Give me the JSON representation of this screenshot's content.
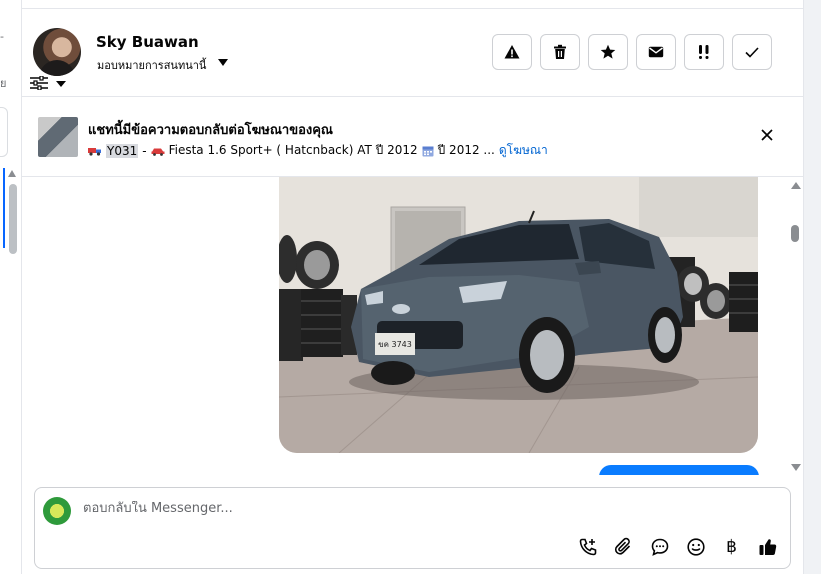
{
  "left_panel": {
    "hint_top": "-",
    "hint_mid": "ย"
  },
  "contact": {
    "name": "Sky Buawan",
    "assign_label": "มอบหมายการสนทนานี้"
  },
  "header_actions": [
    {
      "icon": "warning-icon"
    },
    {
      "icon": "trash-icon"
    },
    {
      "icon": "star-icon"
    },
    {
      "icon": "envelope-icon"
    },
    {
      "icon": "double-exclamation-icon"
    },
    {
      "icon": "check-icon"
    }
  ],
  "ad_banner": {
    "title": "แชทนี้มีข้อความตอบกลับต่อโฆษณาของคุณ",
    "code": "Y031",
    "separator": "-",
    "model": "Fiesta 1.6 Sport+ ( Hatcnback) AT ปี 2012",
    "year": "ปี 2012 ...",
    "link": "ดูโฆษณา"
  },
  "photo": {
    "plate": "ขค 3743"
  },
  "composer": {
    "placeholder": "ตอบกลับใน Messenger...",
    "tools": [
      "phone-plus-icon",
      "paperclip-icon",
      "chat-bubble-icon",
      "smiley-icon",
      "baht-icon",
      "thumbs-up-icon"
    ],
    "baht_symbol": "฿"
  },
  "colors": {
    "accent": "#0a7cff",
    "link": "#0064d1",
    "border": "#ced0d4"
  }
}
